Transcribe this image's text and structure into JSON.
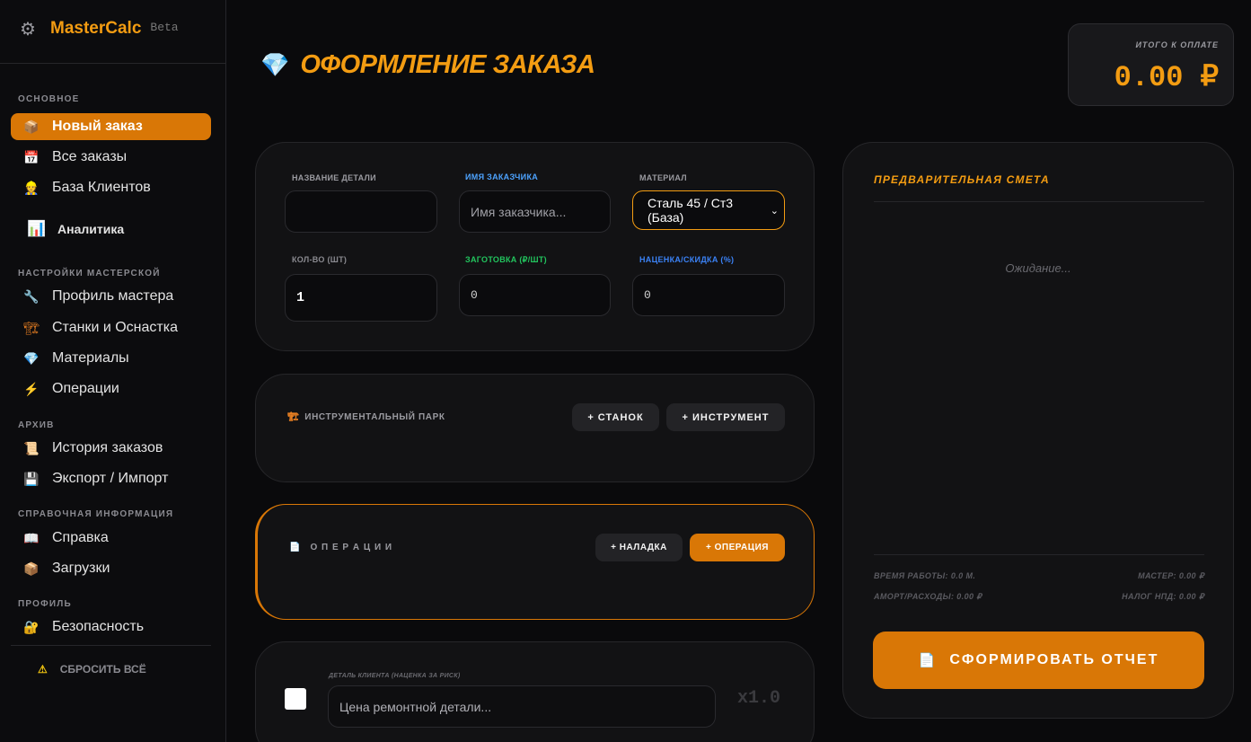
{
  "app": {
    "name": "MasterCalc",
    "badge": "Beta"
  },
  "sidebar": {
    "sections": {
      "basic": "ОСНОВНОЕ",
      "workshop": "НАСТРОЙКИ МАСТЕРСКОЙ",
      "archive": "АРХИВ",
      "reference": "СПРАВОЧНАЯ ИНФОРМАЦИЯ",
      "profile": "ПРОФИЛЬ"
    },
    "items": {
      "new_order": "Новый заказ",
      "all_orders": "Все заказы",
      "clients": "База Клиентов",
      "analytics": "Аналитика",
      "master_profile": "Профиль мастера",
      "machines": "Станки и Оснастка",
      "materials": "Материалы",
      "operations": "Операции",
      "history": "История заказов",
      "export_import": "Экспорт / Импорт",
      "help": "Справка",
      "downloads": "Загрузки",
      "security": "Безопасность"
    },
    "reset": "СБРОСИТЬ ВСЁ"
  },
  "header": {
    "title": "ОФОРМЛЕНИЕ ЗАКАЗА",
    "total_label": "ИТОГО К ОПЛАТЕ",
    "total_value": "0.00 ₽"
  },
  "form": {
    "part_name_label": "НАЗВАНИЕ ДЕТАЛИ",
    "part_name_value": "",
    "customer_label": "ИМЯ ЗАКАЗЧИКА",
    "customer_placeholder": "Имя заказчика...",
    "material_label": "МАТЕРИАЛ",
    "material_value": "Сталь 45 / Ст3 (База)",
    "qty_label": "КОЛ-ВО (ШТ)",
    "qty_value": "1",
    "blank_label": "ЗАГОТОВКА (₽/ШТ)",
    "blank_value": "0",
    "markup_label": "НАЦЕНКА/СКИДКА (%)",
    "markup_value": "0"
  },
  "tools": {
    "title": "ИНСТРУМЕНТАЛЬНЫЙ ПАРК",
    "add_machine": "+ СТАНОК",
    "add_tool": "+ ИНСТРУМЕНТ"
  },
  "operations": {
    "title": "О П Е Р А Ц И И",
    "add_setup": "+ НАЛАДКА",
    "add_operation": "+ ОПЕРАЦИЯ"
  },
  "client_part": {
    "label": "ДЕТАЛЬ КЛИЕНТА (НАЦЕНКА ЗА РИСК)",
    "placeholder": "Цена ремонтной детали...",
    "multiplier": "x1.0"
  },
  "estimate": {
    "title": "ПРЕДВАРИТЕЛЬНАЯ СМЕТА",
    "waiting": "Ожидание...",
    "work_time": "ВРЕМЯ РАБОТЫ: 0.0 М.",
    "master": "МАСТЕР: 0.00 ₽",
    "amort": "АМОРТ/РАСХОДЫ: 0.00 ₽",
    "tax": "НАЛОГ НПД: 0.00 ₽",
    "report_button": "СФОРМИРОВАТЬ ОТЧЕТ"
  },
  "colors": {
    "accent": "#f39c12",
    "accent_dark": "#d97706",
    "customer_label": "#4da3ff",
    "blank_label": "#22c55e",
    "markup_label": "#3b82f6"
  }
}
